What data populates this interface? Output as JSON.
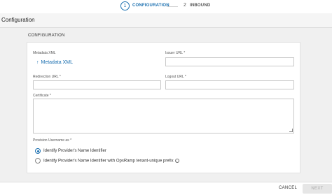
{
  "stepper": {
    "step1_number": "1",
    "step1_label": "CONFIGURATION",
    "step2_number": "2",
    "step2_label": "INBOUND"
  },
  "header": {
    "title": "Configuration"
  },
  "section": {
    "title": "CONFIGURATION"
  },
  "form": {
    "metadata_label": "Metadata XML",
    "metadata_link": "Metadata XML",
    "issuer_label": "Issuer URL *",
    "redirection_label": "Redirection URL *",
    "logout_label": "Logout URL *",
    "certificate_label": "Certificate *",
    "provision_label": "Provision Username as *",
    "option1": "Identify Provider's Name Identifier",
    "option2": "Identify Provider's Name Identifier with OpsRamp tenant-unique prefix"
  },
  "footer": {
    "cancel": "CANCEL",
    "next": "NEXT"
  }
}
